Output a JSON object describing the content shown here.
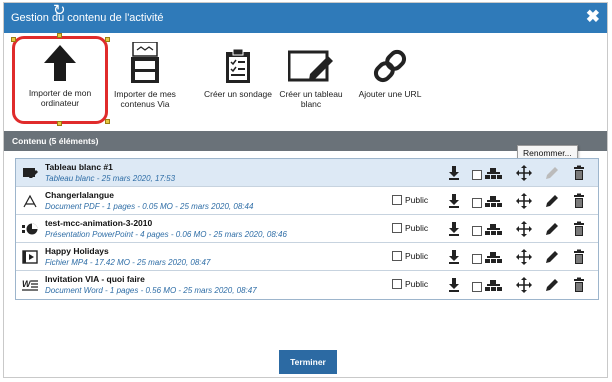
{
  "dialog": {
    "title": "Gestion du contenu de l'activité",
    "close_glyph": "✖",
    "drag_glyph": "↻"
  },
  "toolbar": {
    "items": [
      {
        "label": "Importer de mon ordinateur",
        "icon": "upload-arrow-icon"
      },
      {
        "label": "Importer de mes contenus Via",
        "icon": "file-cabinet-icon"
      },
      {
        "label": "Créer un sondage",
        "icon": "clipboard-checklist-icon"
      },
      {
        "label": "Créer un tableau blanc",
        "icon": "whiteboard-pencil-icon"
      },
      {
        "label": "Ajouter une URL",
        "icon": "chain-link-icon"
      }
    ]
  },
  "content": {
    "header": "Contenu (5 éléments)",
    "public_label": "Public",
    "rows": [
      {
        "name": "Tableau blanc #1",
        "meta": "Tableau blanc - 25 mars 2020, 17:53",
        "type_icon": "whiteboard-icon",
        "has_public": false
      },
      {
        "name": "Changerlalangue",
        "meta": "Document PDF - 1 pages - 0.05 MO - 25 mars 2020, 08:44",
        "type_icon": "pdf-icon",
        "has_public": true
      },
      {
        "name": "test-mcc-animation-3-2010",
        "meta": "Présentation PowerPoint - 4 pages - 0.06 MO - 25 mars 2020, 08:46",
        "type_icon": "powerpoint-icon",
        "has_public": true
      },
      {
        "name": "Happy Holidays",
        "meta": "Fichier MP4 - 17.42 MO - 25 mars 2020, 08:47",
        "type_icon": "video-icon",
        "has_public": true
      },
      {
        "name": "Invitation VIA - quoi faire",
        "meta": "Document Word - 1 pages - 0.56 MO - 25 mars 2020, 08:47",
        "type_icon": "word-icon",
        "has_public": true
      }
    ]
  },
  "tooltip": "Renommer...",
  "footer": {
    "finish_label": "Terminer"
  },
  "colors": {
    "titlebar": "#2f7ab9",
    "section_bar": "#6a7279",
    "selected_outline": "#e02b2b",
    "finish_button": "#2c6aa3",
    "meta_text": "#2e6da6"
  }
}
